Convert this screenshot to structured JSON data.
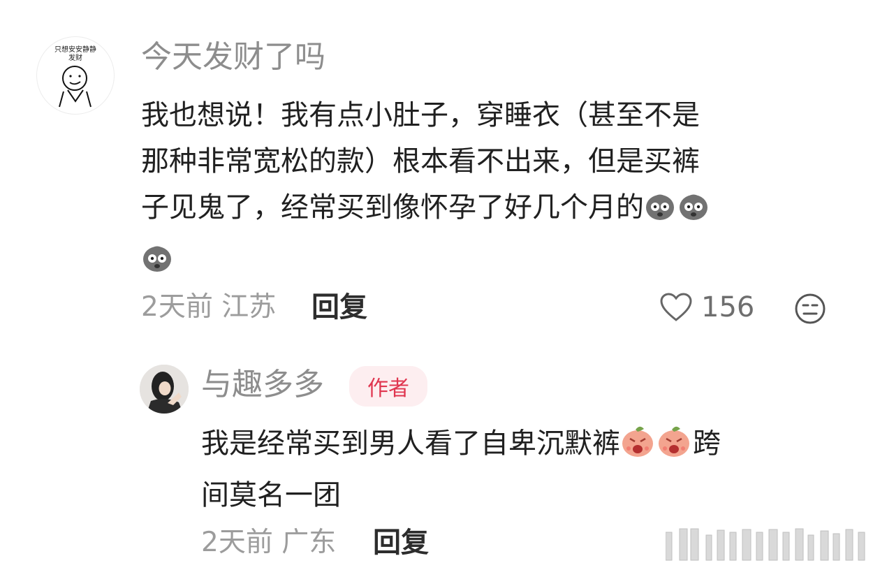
{
  "comment": {
    "username": "今天发财了吗",
    "avatar_caption_top": "只想安安静静",
    "avatar_caption_bottom": "发财",
    "text_lines": [
      "我也想说！我有点小肚子，穿睡衣（甚至不是",
      "那种非常宽松的款）根本看不出来，但是买裤",
      "子见鬼了，经常买到像怀孕了好几个月的"
    ],
    "time": "2天前",
    "location": "江苏",
    "reply_label": "回复",
    "like_count": "156"
  },
  "reply": {
    "username": "与趣多多",
    "badge": "作者",
    "text_line1": "我是经常买到男人看了自卑沉默裤",
    "text_line1_tail": "跨",
    "text_line2": "间莫名一团",
    "time": "2天前",
    "location": "广东",
    "reply_label": "回复"
  },
  "colors": {
    "username": "#8d8d8d",
    "meta": "#9c9c9c",
    "badge_bg": "#fdeef0",
    "badge_text": "#e0354f",
    "emoji_gray": "#6a6a6a",
    "emoji_pink": "#f0a38c"
  },
  "icons": {
    "dislike": "dislike-face-icon",
    "like": "heart-outline-icon",
    "emoji_1": "shocked-gray-emoji-icon",
    "emoji_2": "screaming-peach-emoji-icon"
  }
}
